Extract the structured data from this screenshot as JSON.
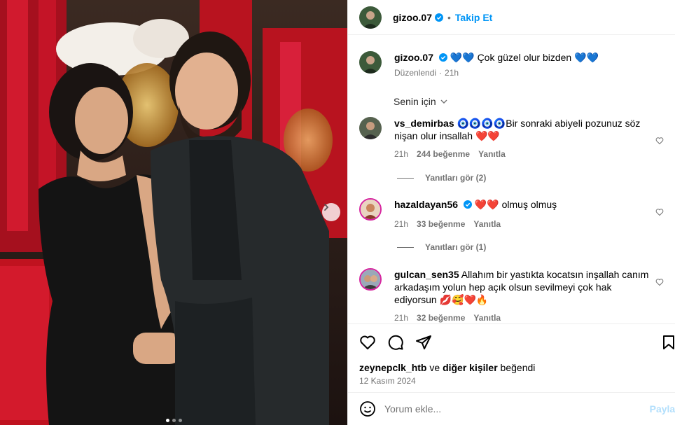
{
  "post": {
    "author": "gizoo.07",
    "follow_label": "Takip Et",
    "caption_emoji_before": "💙💙",
    "caption_text": "Çok güzel olur bizden",
    "caption_emoji_after": "💙💙",
    "edited_label": "Düzenlendi",
    "caption_time": "21h",
    "likes_user": "zeynepclk_htb",
    "likes_and": "ve",
    "likes_others": "diğer kişiler",
    "likes_suffix": "beğendi",
    "date": "12 Kasım 2024",
    "carousel_index": 1,
    "carousel_total": 3
  },
  "sort": {
    "label": "Senin için"
  },
  "comments": [
    {
      "user": "vs_demirbas",
      "verified": false,
      "text": "🧿🧿🧿🧿Bir sonraki abiyeli pozunuz söz nişan olur insallah ❤️❤️",
      "time": "21h",
      "likes": "244 beğenme",
      "reply": "Yanıtla",
      "view_replies": "Yanıtları gör (2)"
    },
    {
      "user": "hazaldayan56",
      "verified": true,
      "text": "❤️❤️ olmuş olmuş",
      "time": "21h",
      "likes": "33 beğenme",
      "reply": "Yanıtla",
      "view_replies": "Yanıtları gör (1)"
    },
    {
      "user": "gulcan_sen35",
      "verified": false,
      "text": "Allahım bir yastıkta kocatsın inşallah canım arkadaşım yolun hep açık olsun sevilmeyi çok hak ediyorsun 💋🥰❤️🔥",
      "time": "21h",
      "likes": "32 beğenme",
      "reply": "Yanıtla"
    }
  ],
  "composer": {
    "placeholder": "Yorum ekle...",
    "post_label": "Paylaş"
  },
  "icons": {
    "verified": "verified-badge-icon",
    "like": "heart-icon",
    "comment": "comment-bubble-icon",
    "share": "paper-plane-icon",
    "save": "bookmark-icon",
    "emoji": "smiley-icon",
    "next": "chevron-right-icon",
    "chevron_down": "chevron-down-icon"
  },
  "colors": {
    "accent": "#0095f6",
    "secondary_text": "#737373",
    "border": "#efefef",
    "heart_red": "#ff3040"
  }
}
